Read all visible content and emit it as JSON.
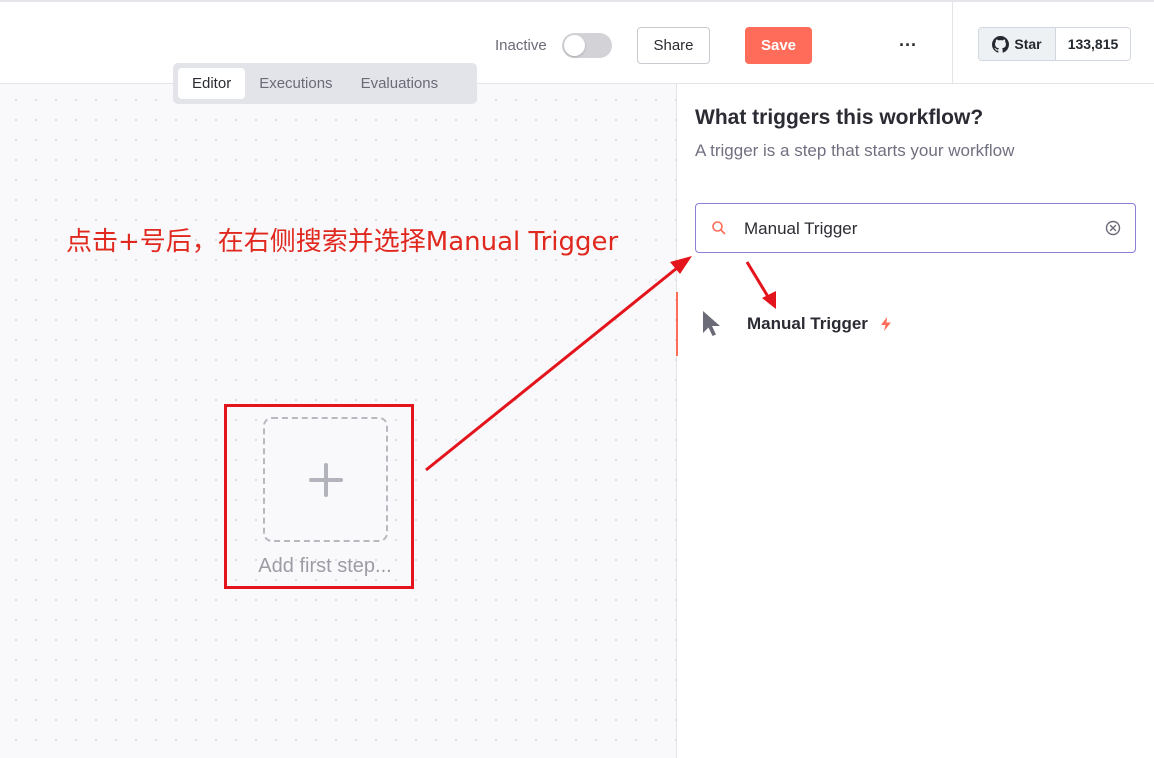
{
  "header": {
    "status_label": "Inactive",
    "share_label": "Share",
    "save_label": "Save",
    "more_label": "···",
    "github": {
      "star_label": "Star",
      "star_count": "133,815"
    },
    "colors": {
      "save": "#ff6d5a",
      "toggle_off": "#d2d2d7"
    }
  },
  "tabs": [
    {
      "label": "Editor",
      "active": true
    },
    {
      "label": "Executions",
      "active": false
    },
    {
      "label": "Evaluations",
      "active": false
    }
  ],
  "canvas": {
    "add_first_step_label": "Add first step...",
    "annotation": "点击+号后，在右侧搜索并选择Manual Trigger",
    "annotation_color": "#e0281e"
  },
  "panel": {
    "title": "What triggers this workflow?",
    "subtitle": "A trigger is a step that starts your workflow",
    "search": {
      "value": "Manual Trigger",
      "icon": "search-icon",
      "clear_icon": "clear-circle-icon"
    },
    "results": [
      {
        "label": "Manual Trigger",
        "icon": "cursor-pointer-icon",
        "badge_icon": "bolt-icon"
      }
    ]
  }
}
